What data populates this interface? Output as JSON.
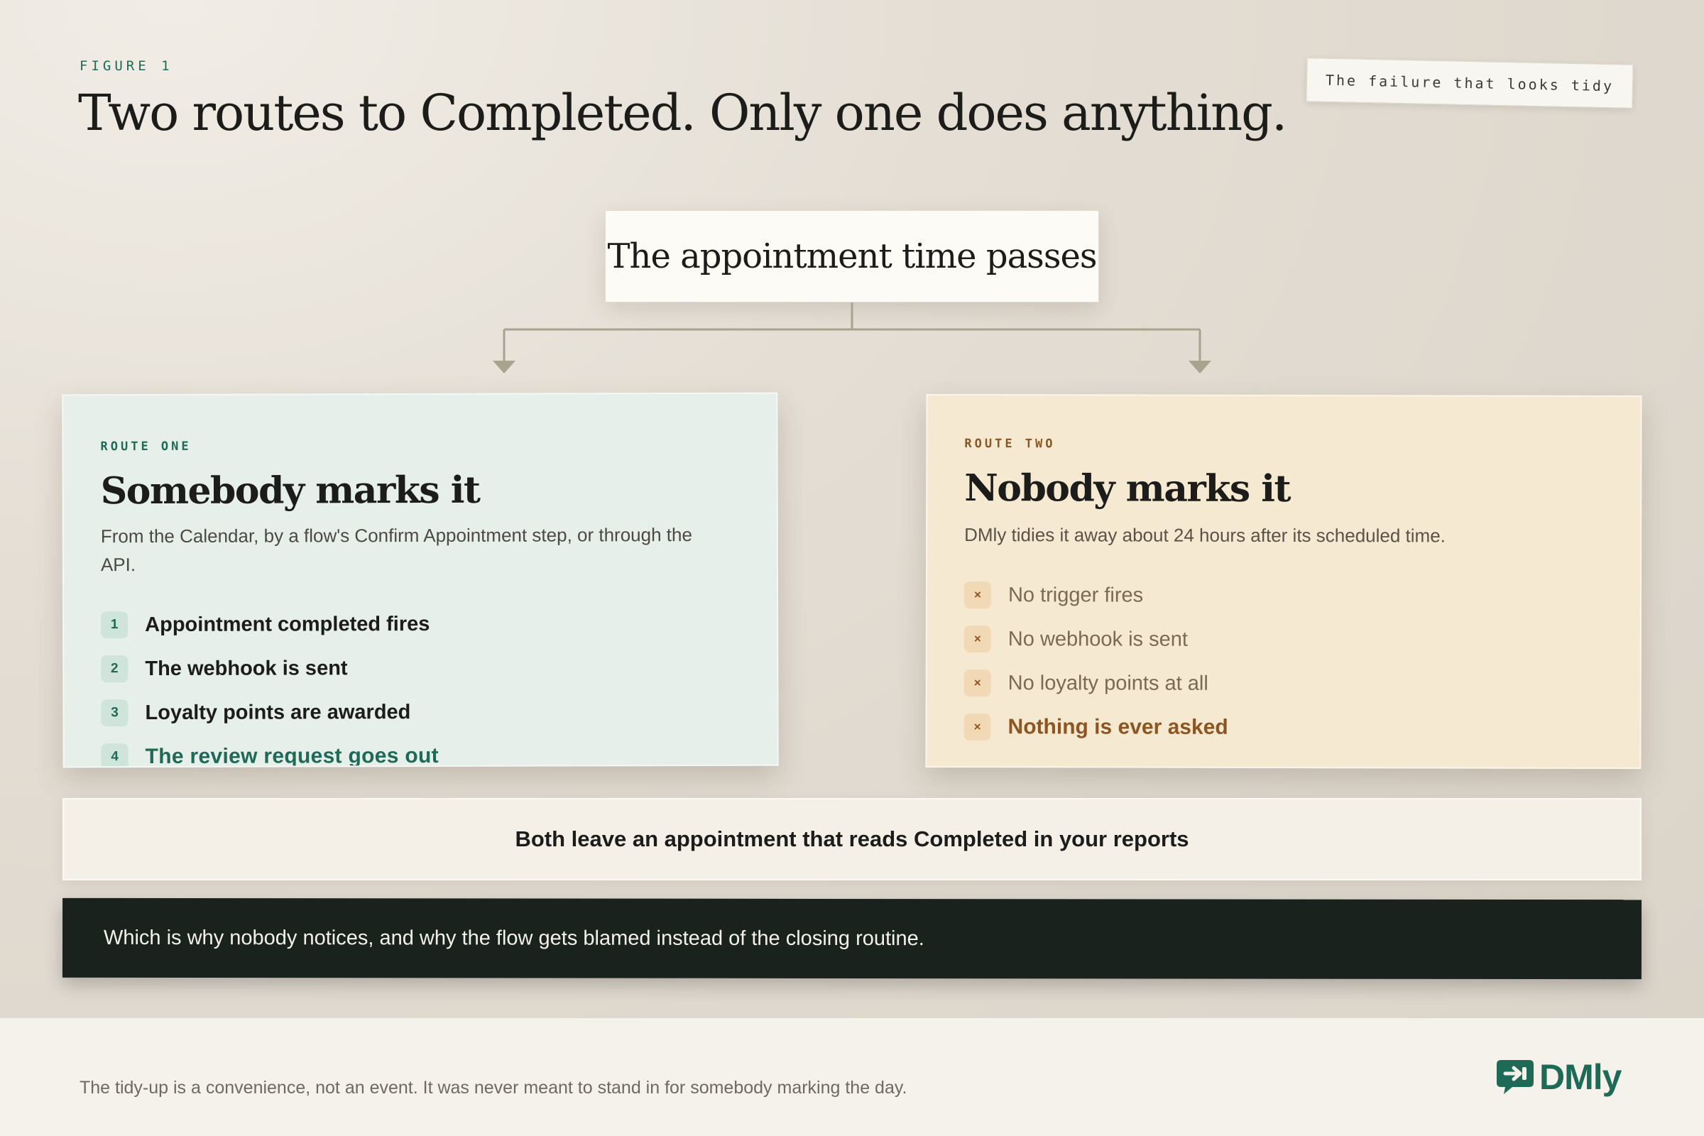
{
  "figure": {
    "eyebrow": "FIGURE 1",
    "title": "Two routes to Completed. Only one does anything.",
    "stamp": "The failure that looks tidy"
  },
  "start_node": {
    "label": "The appointment time passes"
  },
  "route_one": {
    "tag": "ROUTE ONE",
    "title": "Somebody marks it",
    "description": "From the Calendar, by a flow's Confirm Appointment step, or through the API.",
    "steps": [
      {
        "badge": "1",
        "text": "Appointment completed fires"
      },
      {
        "badge": "2",
        "text": "The webhook is sent"
      },
      {
        "badge": "3",
        "text": "Loyalty points are awarded"
      },
      {
        "badge": "4",
        "text": "The review request goes out"
      }
    ]
  },
  "route_two": {
    "tag": "ROUTE TWO",
    "title": "Nobody marks it",
    "description": "DMly tidies it away about 24 hours after its scheduled time.",
    "steps": [
      {
        "badge": "×",
        "text": "No trigger fires"
      },
      {
        "badge": "×",
        "text": "No webhook is sent"
      },
      {
        "badge": "×",
        "text": "No loyalty points at all"
      },
      {
        "badge": "×",
        "text": "Nothing is ever asked"
      }
    ]
  },
  "summary": "Both leave an appointment that reads Completed in your reports",
  "callout": "Which is why nobody notices, and why the flow gets blamed instead of the closing routine.",
  "footer": {
    "note": "The tidy-up is a convenience, not an event. It was never meant to stand in for somebody marking the day.",
    "logo_text": "DMly",
    "logo_icon": "chat-arrow-icon"
  },
  "colors": {
    "accent_green": "#1e6a56",
    "accent_amber": "#8c5521",
    "route_one_bg": "#e6efea",
    "route_two_bg": "#f6e9d2",
    "callout_bg": "#1a221e"
  }
}
